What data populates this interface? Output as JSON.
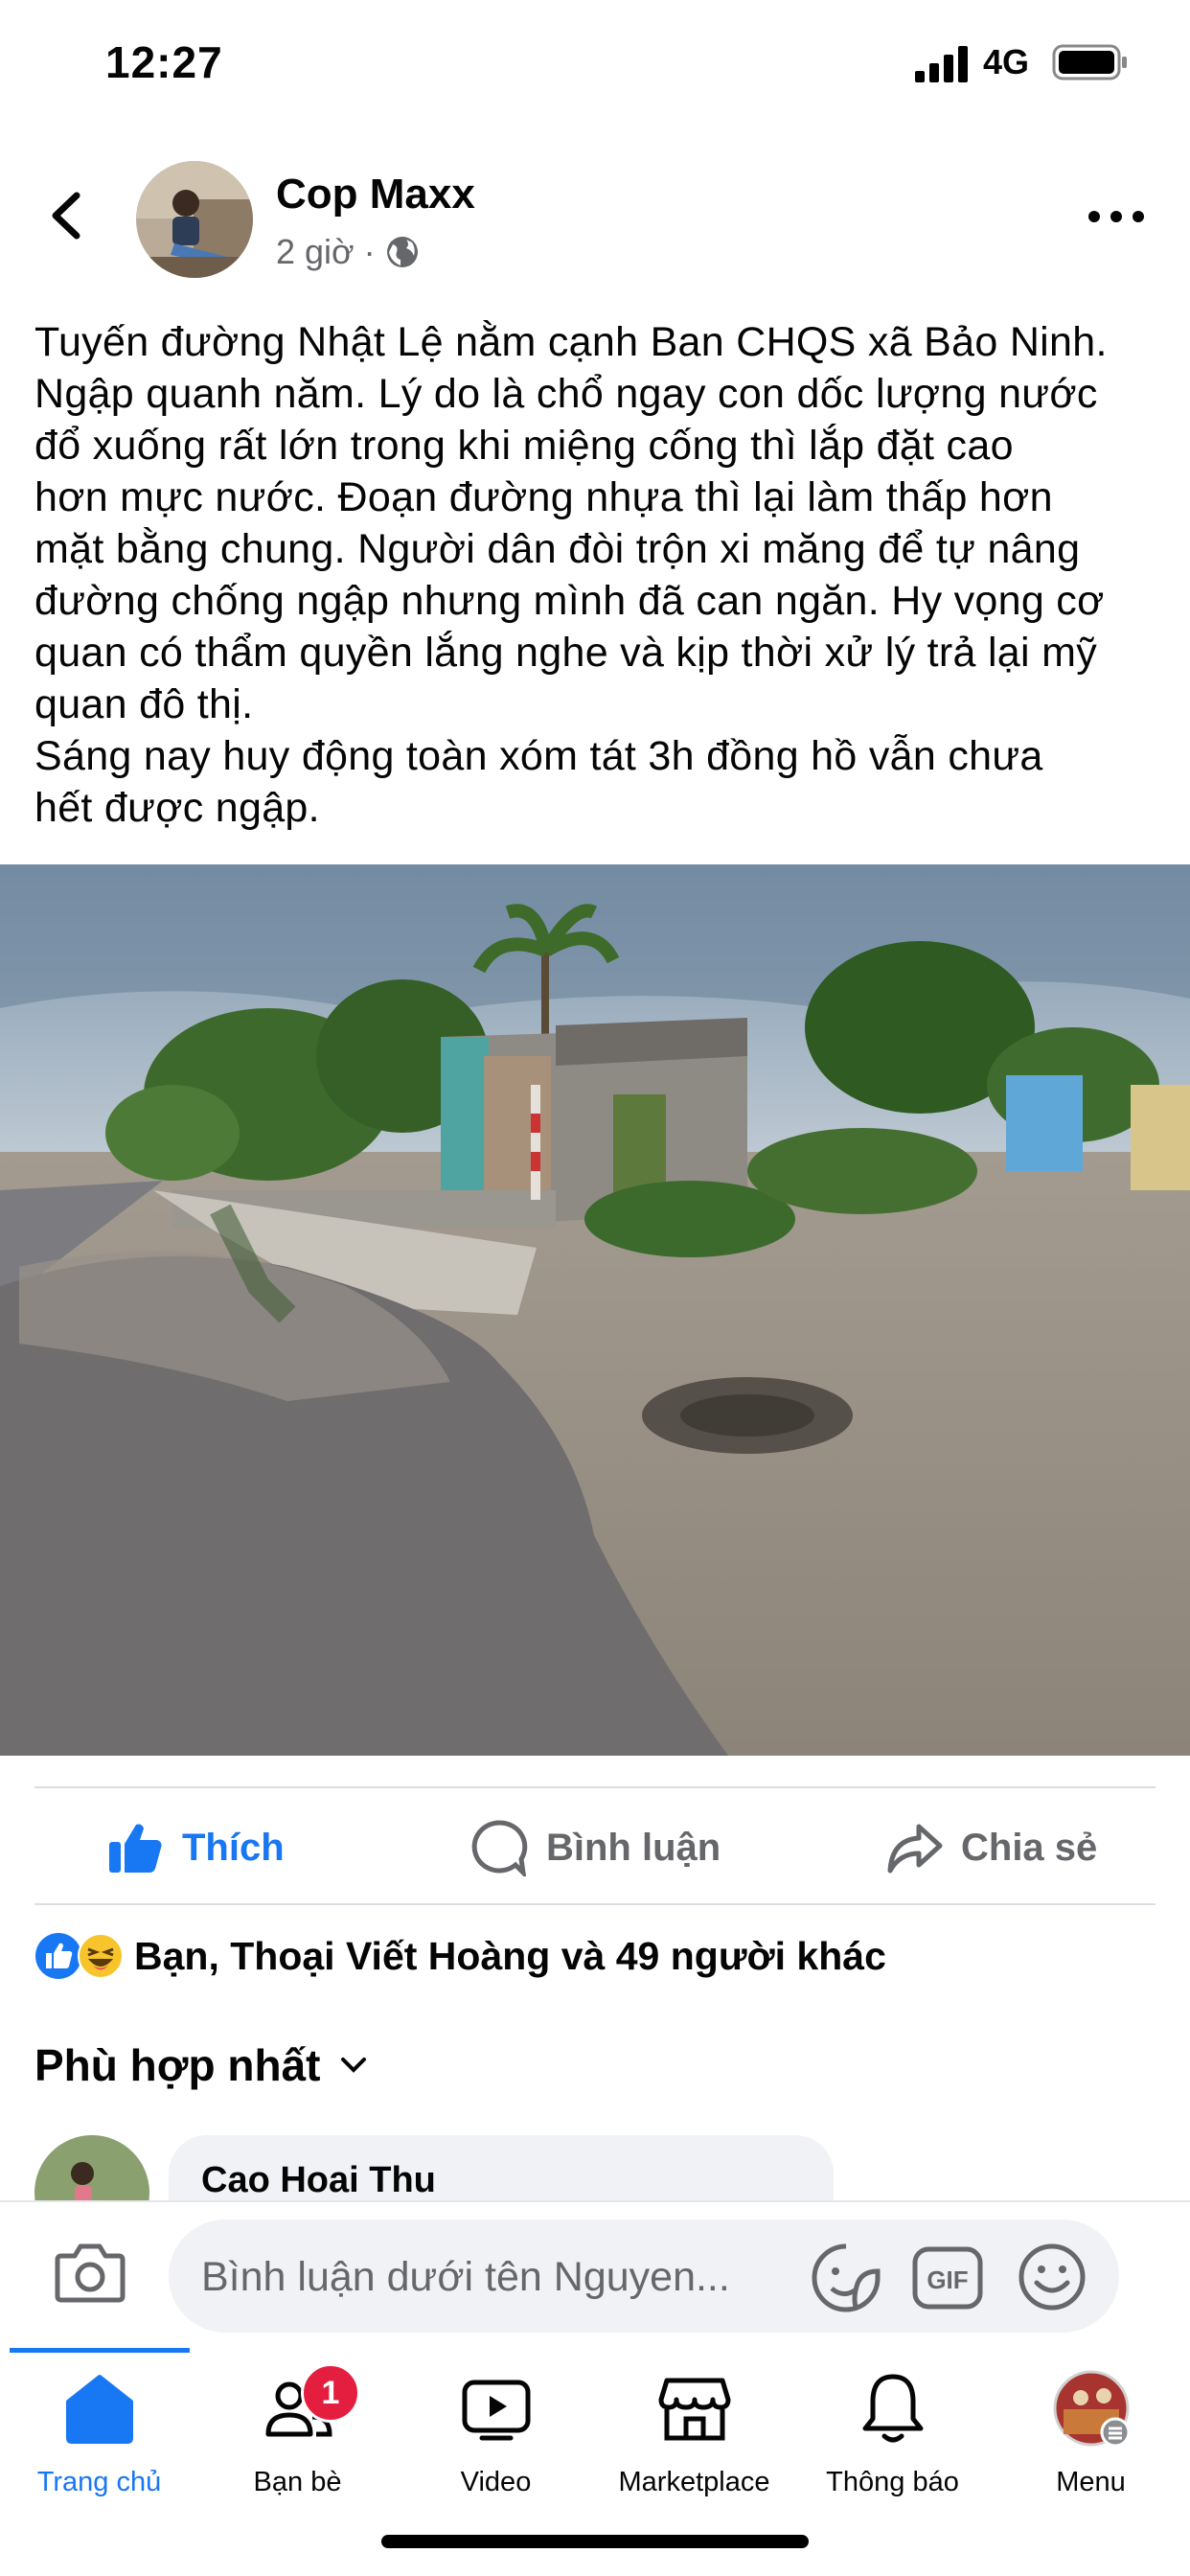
{
  "status_bar": {
    "time": "12:27",
    "network": "4G"
  },
  "post": {
    "author": "Cop Maxx",
    "time": "2 giờ",
    "separator": "·",
    "body": "Tuyến đường Nhật Lệ nằm cạnh Ban CHQS xã Bảo Ninh.\nNgập quanh năm. Lý do là chổ ngay con dốc lượng nước\nđổ xuống rất lớn trong khi miệng cống thì lắp đặt cao\nhơn mực nước. Đoạn đường nhựa thì lại làm thấp hơn\nmặt bằng chung. Người dân đòi trộn xi măng để tự nâng\nđường chống ngập nhưng mình đã can ngăn. Hy vọng cơ\nquan có thẩm quyền lắng nghe và kịp thời xử lý trả lại mỹ\nquan đô thị.\nSáng nay huy động toàn xóm tát 3h đồng hồ vẫn chưa\nhết được ngập."
  },
  "actions": {
    "like": "Thích",
    "comment": "Bình luận",
    "share": "Chia sẻ"
  },
  "reactions": {
    "text": "Bạn, Thoại Viết Hoàng và 49 người khác"
  },
  "comments": {
    "sort_label": "Phù hợp nhất",
    "first": {
      "author": "Cao Hoai Thu"
    }
  },
  "composer": {
    "placeholder": "Bình luận dưới tên Nguyen...",
    "gif_label": "GIF"
  },
  "tabs": [
    {
      "label": "Trang chủ",
      "icon": "home-icon"
    },
    {
      "label": "Bạn bè",
      "icon": "friends-icon",
      "badge": "1"
    },
    {
      "label": "Video",
      "icon": "video-icon"
    },
    {
      "label": "Marketplace",
      "icon": "marketplace-icon"
    },
    {
      "label": "Thông báo",
      "icon": "bell-icon"
    },
    {
      "label": "Menu",
      "icon": "menu-avatar-icon"
    }
  ],
  "colors": {
    "accent": "#1877f2",
    "secondary_text": "#65676b",
    "badge": "#e41e3f"
  }
}
